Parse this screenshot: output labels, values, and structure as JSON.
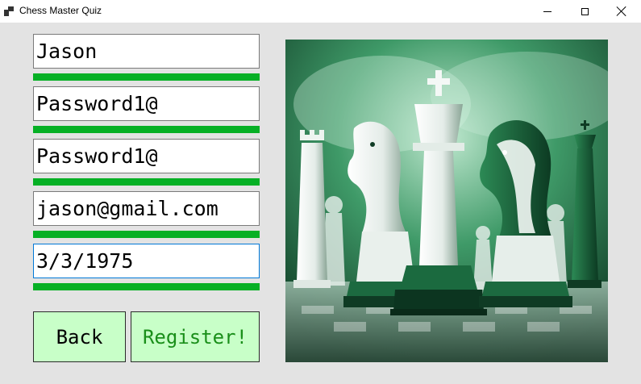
{
  "window": {
    "title": "Chess Master Quiz"
  },
  "form": {
    "fields": [
      {
        "name": "username-field",
        "value": "Jason",
        "strength": 1.0
      },
      {
        "name": "password-field",
        "value": "Password1@",
        "strength": 1.0
      },
      {
        "name": "confirm-password-field",
        "value": "Password1@",
        "strength": 1.0
      },
      {
        "name": "email-field",
        "value": "jason@gmail.com",
        "strength": 1.0
      },
      {
        "name": "birthdate-field",
        "value": "3/3/1975",
        "strength": 1.0
      }
    ]
  },
  "buttons": {
    "back_label": "Back",
    "register_label": "Register!"
  },
  "colors": {
    "validation_bar": "#06b025",
    "button_bg": "#c8ffc8",
    "register_text": "#1a8f1a"
  },
  "image": {
    "icon": "chess-pieces-illustration"
  }
}
